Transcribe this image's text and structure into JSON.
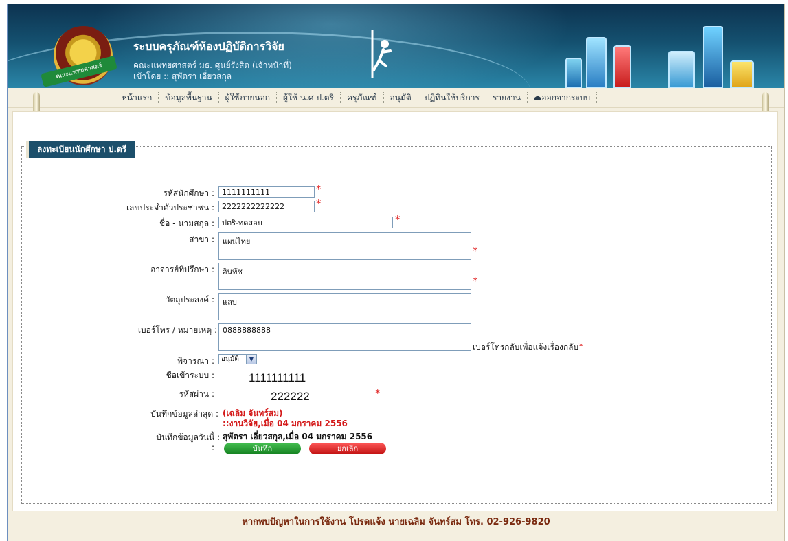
{
  "header": {
    "title": "ระบบครุภัณฑ์ห้องปฏิบัติการวิจัย",
    "subtitle": "คณะแพทยศาสตร์ มธ. ศูนย์รังสิต (เจ้าหน้าที่)",
    "login_prefix": "เข้าโดย :: ",
    "login_user": "สุพัตรา เอี่ยวสกุล",
    "logo_text": "คณะแพทยศาสตร์"
  },
  "menu": {
    "items": [
      "หน้าแรก",
      "ข้อมูลพื้นฐาน",
      "ผู้ใช้ภายนอก",
      "ผู้ใช้ น.ศ ป.ตรี",
      "ครุภัณฑ์",
      "อนุมัติ",
      "ปฏิทินใช้บริการ",
      "รายงาน",
      "ออกจากระบบ"
    ]
  },
  "form": {
    "section_title": "ลงทะเบียนนักศึกษา ป.ตรี",
    "student_id_label": "รหัสนักศึกษา :",
    "student_id": "1111111111",
    "citizen_id_label": "เลขประจำตัวประชาชน :",
    "citizen_id": "2222222222222",
    "name_label": "ชื่อ - นามสกุล :",
    "name": "ปตริ-ทดสอบ",
    "branch_label": "สาขา :",
    "branch": "แผนไทย",
    "advisor_label": "อาจารย์ที่ปรึกษา :",
    "advisor": "อินทัช",
    "purpose_label": "วัตถุประสงค์ :",
    "purpose": "แลบ",
    "phone_label": "เบอร์โทร / หมายเหตุ :",
    "phone": "0888888888",
    "phone_hint": "เบอร์โทรกลับเพื่อแจ้งเรื่องกลับ",
    "consider_label": "พิจารณา :",
    "consider_value": "อนุมัติ",
    "username_label": "ชื่อเข้าระบบ :",
    "username": "1111111111",
    "password_label": "รหัสผ่าน :",
    "password": "222222",
    "last_saved_label": "บันทึกข้อมูลล่าสุด :",
    "last_saved_by": "(เฉลิม จันทร์สม)",
    "last_saved_at": "::งานวิจัย,เมื่อ 04 มกราคม 2556",
    "today_label": "บันทึกข้อมูลวันนี้ :",
    "today_value": "สุพัตรา เอี่ยวสกุล,เมื่อ 04 มกราคม 2556",
    "colon": ":",
    "required_mark": "*",
    "save_label": "บันทึก",
    "cancel_label": "ยกเลิก"
  },
  "footer": {
    "text": "หากพบปัญหาในการใช้งาน โปรดแจ้ง นายเฉลิม จันทร์สม โทร. 02-926-9820"
  },
  "colors": {
    "banner": "#14506f",
    "required": "#e02020",
    "save_button": "#1f8f2a",
    "cancel_button": "#d51a1a",
    "footer_text": "#7a2a10"
  }
}
